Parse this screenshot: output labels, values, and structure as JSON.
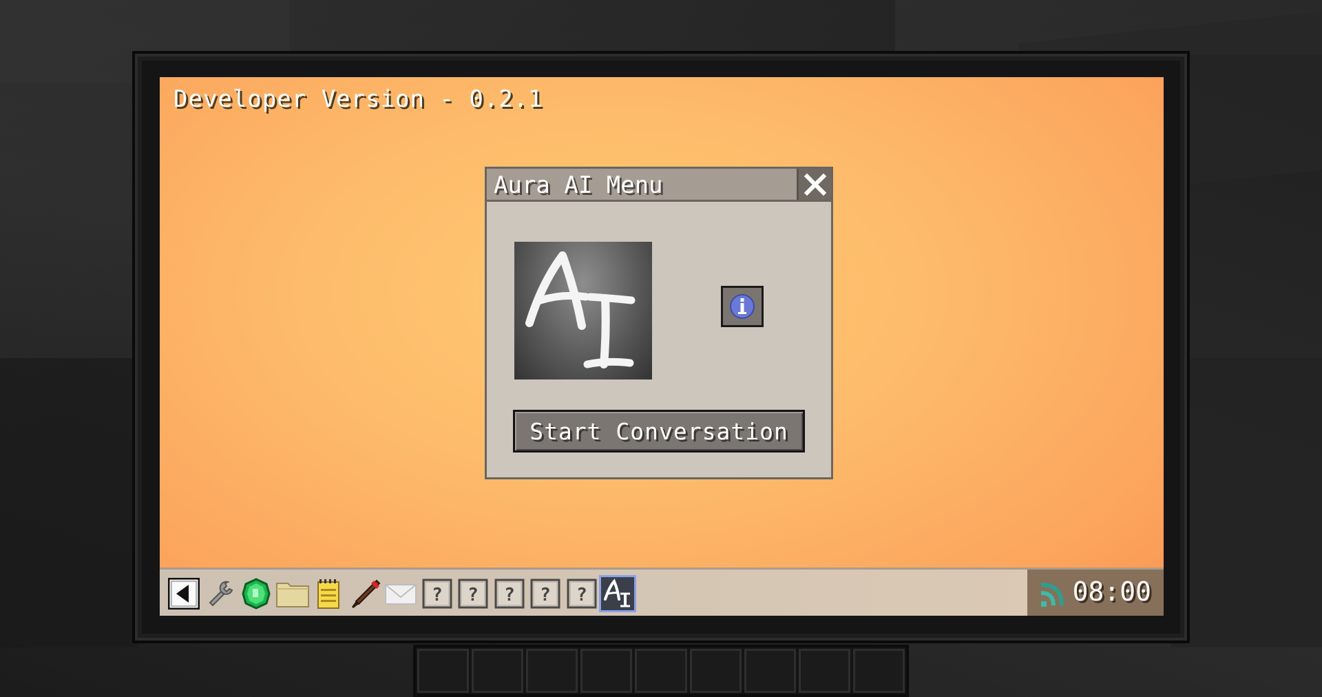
{
  "os": {
    "version_label": "Developer Version - 0.2.1"
  },
  "dialog": {
    "title": "Aura AI Menu",
    "logo_text": "AI",
    "start_button_label": "Start Conversation"
  },
  "taskbar": {
    "items": [
      {
        "name": "back-icon"
      },
      {
        "name": "wrench-icon"
      },
      {
        "name": "emerald-icon"
      },
      {
        "name": "folder-icon"
      },
      {
        "name": "notepad-icon"
      },
      {
        "name": "brush-icon"
      },
      {
        "name": "mail-icon"
      },
      {
        "name": "unknown-app-icon"
      },
      {
        "name": "unknown-app-icon"
      },
      {
        "name": "unknown-app-icon"
      },
      {
        "name": "unknown-app-icon"
      },
      {
        "name": "unknown-app-icon"
      },
      {
        "name": "ai-app-icon",
        "active": true
      }
    ],
    "unknown_glyph": "?",
    "ai_glyph": "AI",
    "clock": "08:00"
  },
  "colors": {
    "accent": "#8aa0e8",
    "wallpaper_center": "#ffca73",
    "wallpaper_edge": "#f99652",
    "dialog_body": "#cdc6bd",
    "dialog_titlebar": "#a59d94"
  }
}
